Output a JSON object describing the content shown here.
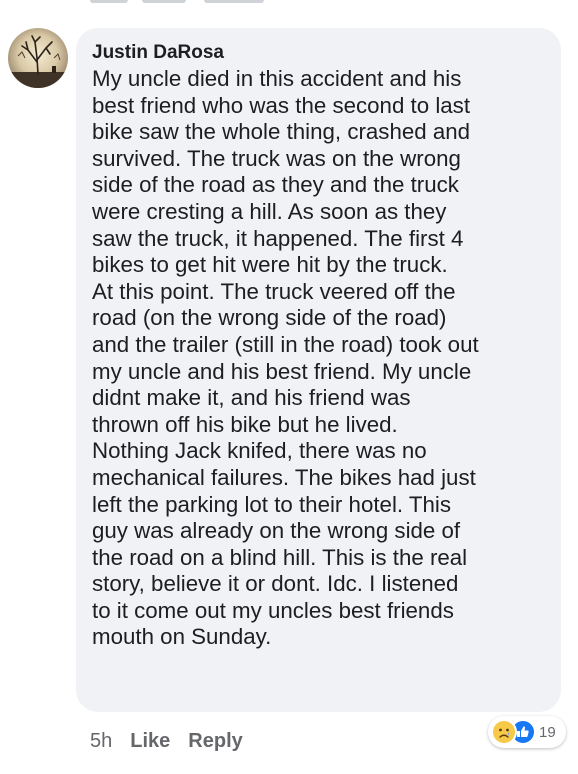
{
  "comment": {
    "author": "Justin DaRosa",
    "lines": [
      "My uncle died in this accident and his",
      "best friend who was the second to last",
      "bike saw the whole thing, crashed and",
      "survived.  The truck was on the wrong",
      "side of the road as they and the truck",
      "were cresting a hill.  As soon as they",
      "saw the truck, it happened. The first 4",
      "bikes to get hit were hit by the truck.",
      "At this point. The truck veered off the",
      "road (on the wrong side of the road)",
      "and the trailer (still in the road) took out",
      "my uncle and his best friend.  My uncle",
      "didnt make it, and his friend was",
      "thrown off his bike but he lived.",
      "Nothing Jack knifed, there was no",
      "mechanical failures.  The bikes had just",
      "left the parking lot to their hotel.  This",
      "guy was already on the wrong side of",
      "the road on a blind hill.  This is the real",
      "story, believe it or dont.  Idc.  I listened",
      "to it come out my uncles best friends",
      "mouth on Sunday."
    ]
  },
  "actions": {
    "timestamp": "5h",
    "like_label": "Like",
    "reply_label": "Reply"
  },
  "reactions": {
    "icons": [
      "sad-reaction-icon",
      "like-reaction-icon"
    ],
    "count": "19"
  },
  "colors": {
    "bubble_bg": "#f0f2f5",
    "text": "#1c1e21",
    "secondary": "#65676b",
    "like_blue": "#1877f2",
    "sad_yellow": "#f7c949"
  }
}
